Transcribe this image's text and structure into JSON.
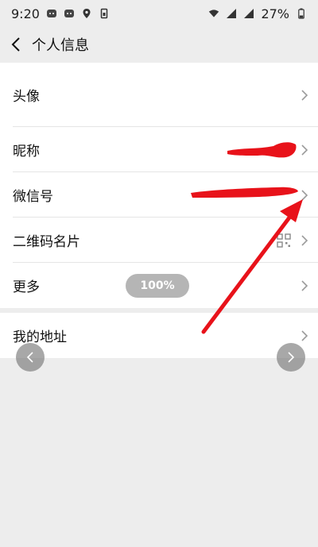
{
  "status_bar": {
    "time": "9:20",
    "battery": "27%",
    "icons": [
      "wechat-icon",
      "wechat-icon",
      "location-icon",
      "sim-icon",
      "wifi-icon",
      "signal-icon",
      "signal-icon",
      "battery-icon"
    ]
  },
  "nav": {
    "title": "个人信息"
  },
  "rows": {
    "avatar": "头像",
    "nickname": "昵称",
    "wechat_id": "微信号",
    "qr_card": "二维码名片",
    "more": "更多",
    "address": "我的地址"
  },
  "overlay": {
    "zoom": "100%"
  },
  "colors": {
    "accent_red": "#e8121a",
    "background": "#ededed"
  }
}
